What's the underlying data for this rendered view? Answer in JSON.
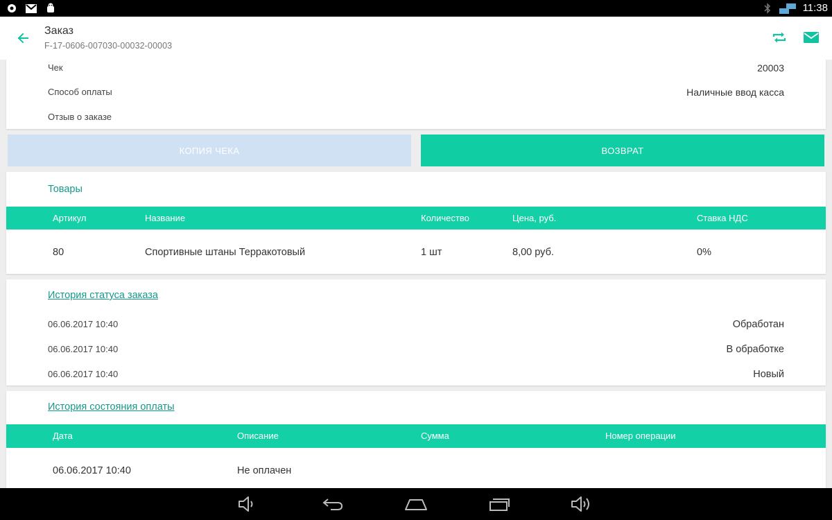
{
  "statusbar": {
    "time": "11:38"
  },
  "appbar": {
    "title": "Заказ",
    "subtitle": "F-17-0606-007030-00032-00003"
  },
  "info": {
    "rows": [
      {
        "label": "Чек",
        "value": "20003"
      },
      {
        "label": "Способ оплаты",
        "value": "Наличные ввод касса"
      },
      {
        "label": "Отзыв о заказе",
        "value": ""
      }
    ]
  },
  "buttons": {
    "copy": "КОПИЯ ЧЕКА",
    "return": "ВОЗВРАТ"
  },
  "goods": {
    "title": "Товары",
    "headers": [
      "Артикул",
      "Название",
      "Количество",
      "Цена, руб.",
      "Ставка НДС"
    ],
    "rows": [
      [
        "80",
        "Спортивные штаны Терракотовый",
        "1 шт",
        "8,00 руб.",
        "0%"
      ]
    ]
  },
  "status_history": {
    "title": "История статуса заказа",
    "rows": [
      {
        "date": "06.06.2017 10:40",
        "status": "Обработан"
      },
      {
        "date": "06.06.2017 10:40",
        "status": "В обработке"
      },
      {
        "date": "06.06.2017 10:40",
        "status": "Новый"
      }
    ]
  },
  "payment_history": {
    "title": "История состояния оплаты",
    "headers": [
      "Дата",
      "Описание",
      "Сумма",
      "Номер операции"
    ],
    "rows": [
      [
        "06.06.2017 10:40",
        "Не оплачен",
        "",
        ""
      ]
    ]
  },
  "colors": {
    "accent": "#13d0a6",
    "link": "#14998a",
    "disabled_button": "#cfe1f2"
  },
  "icons": {
    "back": "arrow-left-icon",
    "sync": "repeat-icon",
    "mail": "mail-icon",
    "nav": [
      "volume-down-icon",
      "back-nav-icon",
      "home-icon",
      "recents-icon",
      "volume-up-icon"
    ]
  }
}
